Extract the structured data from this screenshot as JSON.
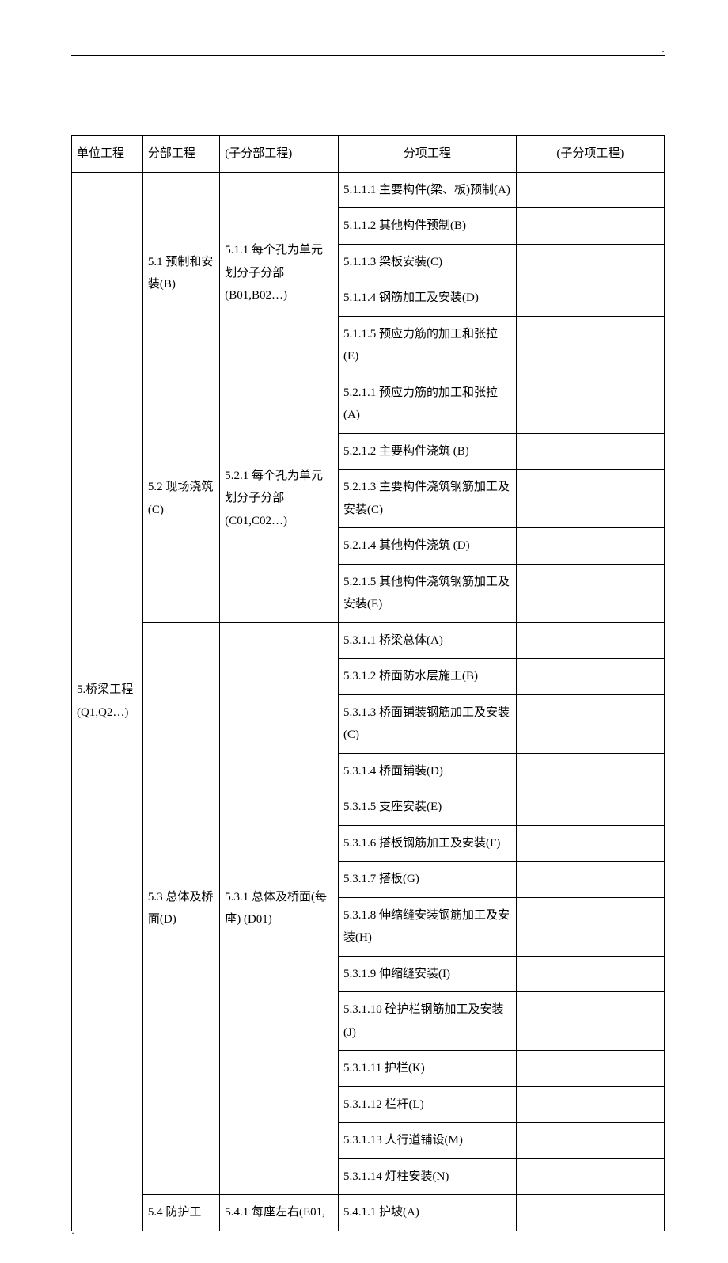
{
  "marks": {
    "top": "·",
    "bottom": "·"
  },
  "headers": {
    "c1": "单位工程",
    "c2": "分部工程",
    "c3": "(子分部工程)",
    "c4": "分项工程",
    "c5": "(子分项工程)"
  },
  "unit": "5.桥梁工程(Q1,Q2…)",
  "g1": {
    "division": "5.1 预制和安装(B)",
    "sub": "5.1.1 每个孔为单元划分子分部(B01,B02…)",
    "items": [
      "5.1.1.1 主要构件(梁、板)预制(A)",
      "5.1.1.2 其他构件预制(B)",
      "5.1.1.3 梁板安装(C)",
      "5.1.1.4 钢筋加工及安装(D)",
      "5.1.1.5 预应力筋的加工和张拉(E)"
    ]
  },
  "g2": {
    "division": "5.2 现场浇筑(C)",
    "sub": "5.2.1 每个孔为单元划分子分部(C01,C02…)",
    "items": [
      "5.2.1.1 预应力筋的加工和张拉(A)",
      "5.2.1.2 主要构件浇筑 (B)",
      "5.2.1.3 主要构件浇筑钢筋加工及安装(C)",
      "5.2.1.4 其他构件浇筑 (D)",
      "5.2.1.5 其他构件浇筑钢筋加工及安装(E)"
    ]
  },
  "g3": {
    "division": "5.3 总体及桥面(D)",
    "sub": "5.3.1 总体及桥面(每座) (D01)",
    "items": [
      "5.3.1.1 桥梁总体(A)",
      "5.3.1.2 桥面防水层施工(B)",
      "5.3.1.3 桥面铺装钢筋加工及安装(C)",
      "5.3.1.4 桥面铺装(D)",
      "5.3.1.5 支座安装(E)",
      "5.3.1.6 搭板钢筋加工及安装(F)",
      "5.3.1.7 搭板(G)",
      "5.3.1.8 伸缩缝安装钢筋加工及安装(H)",
      "5.3.1.9 伸缩缝安装(I)",
      "5.3.1.10 砼护栏钢筋加工及安装(J)",
      "5.3.1.11 护栏(K)",
      "5.3.1.12 栏杆(L)",
      "5.3.1.13 人行道铺设(M)",
      "5.3.1.14 灯柱安装(N)"
    ]
  },
  "g4": {
    "division": "5.4 防护工",
    "sub": "5.4.1 每座左右(E01,",
    "items": [
      "5.4.1.1 护坡(A)"
    ]
  }
}
